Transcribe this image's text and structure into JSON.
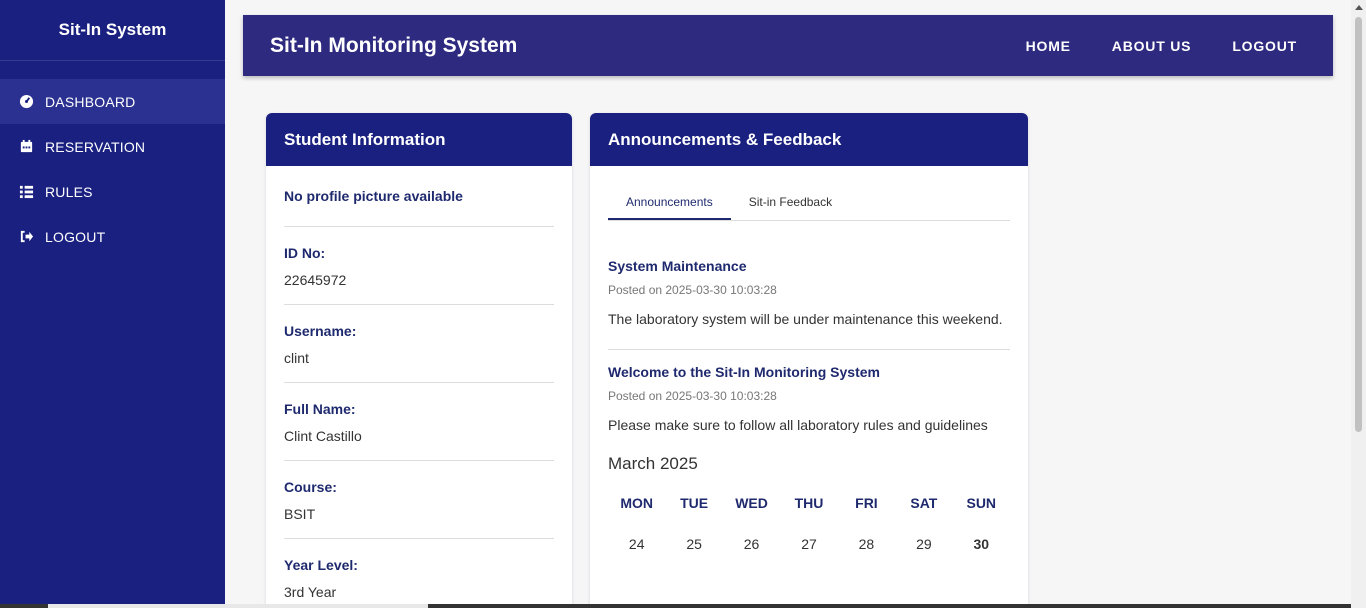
{
  "sidebar": {
    "brand": "Sit-In System",
    "items": [
      {
        "label": "DASHBOARD",
        "icon": "dashboard-icon"
      },
      {
        "label": "RESERVATION",
        "icon": "calendar-icon"
      },
      {
        "label": "RULES",
        "icon": "list-icon"
      },
      {
        "label": "LOGOUT",
        "icon": "logout-icon"
      }
    ]
  },
  "header": {
    "title": "Sit-In Monitoring System",
    "nav": [
      "HOME",
      "ABOUT US",
      "LOGOUT"
    ]
  },
  "student": {
    "title": "Student Information",
    "no_profile": "No profile picture available",
    "fields": [
      {
        "label": "ID No:",
        "value": "22645972"
      },
      {
        "label": "Username:",
        "value": "clint"
      },
      {
        "label": "Full Name:",
        "value": "Clint Castillo"
      },
      {
        "label": "Course:",
        "value": "BSIT"
      },
      {
        "label": "Year Level:",
        "value": "3rd Year"
      }
    ]
  },
  "announcements": {
    "title": "Announcements & Feedback",
    "tabs": [
      "Announcements",
      "Sit-in Feedback"
    ],
    "active_tab": "Announcements",
    "items": [
      {
        "title": "System Maintenance",
        "date": "Posted on 2025-03-30 10:03:28",
        "text": "The laboratory system will be under maintenance this weekend."
      },
      {
        "title": "Welcome to the Sit-In Monitoring System",
        "date": "Posted on 2025-03-30 10:03:28",
        "text": "Please make sure to follow all laboratory rules and guidelines"
      }
    ]
  },
  "calendar": {
    "month": "March 2025",
    "weekdays": [
      "MON",
      "TUE",
      "WED",
      "THU",
      "FRI",
      "SAT",
      "SUN"
    ],
    "days": [
      "24",
      "25",
      "26",
      "27",
      "28",
      "29",
      "30"
    ],
    "today": "30"
  },
  "colors": {
    "sidebar": "#1a2080",
    "topbar": "#2e2a7f",
    "accent": "#1f2a6e"
  }
}
